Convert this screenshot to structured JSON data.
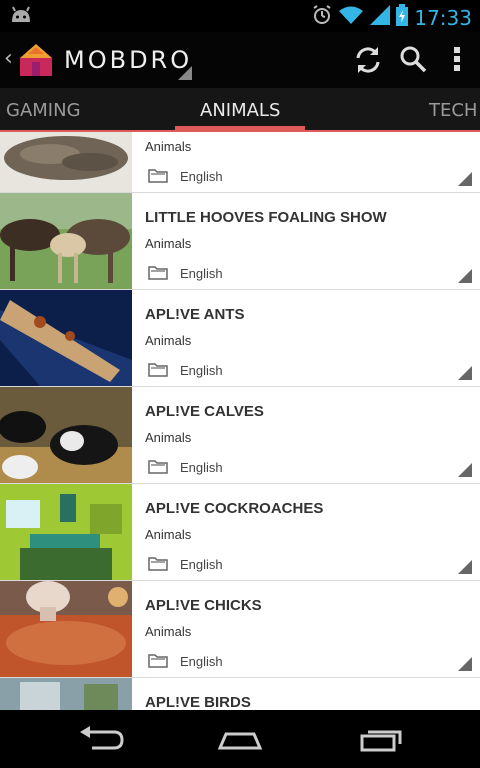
{
  "status": {
    "time": "17:33"
  },
  "header": {
    "title": "MOBDRO"
  },
  "tabs": [
    {
      "label": "GAMING"
    },
    {
      "label": "ANIMALS"
    },
    {
      "label": "TECH"
    }
  ],
  "streams": [
    {
      "title": "",
      "category": "Animals",
      "language": "English"
    },
    {
      "title": "LITTLE HOOVES FOALING SHOW",
      "category": "Animals",
      "language": "English"
    },
    {
      "title": "APL!VE ANTS",
      "category": "Animals",
      "language": "English"
    },
    {
      "title": "APL!VE CALVES",
      "category": "Animals",
      "language": "English"
    },
    {
      "title": "APL!VE COCKROACHES",
      "category": "Animals",
      "language": "English"
    },
    {
      "title": "APL!VE CHICKS",
      "category": "Animals",
      "language": "English"
    },
    {
      "title": "APL!VE BIRDS",
      "category": "",
      "language": ""
    }
  ],
  "icons": {
    "android": "android-icon",
    "alarm": "alarm-icon",
    "wifi": "wifi-icon",
    "signal": "signal-icon",
    "battery": "battery-icon",
    "refresh": "refresh-icon",
    "search": "search-icon",
    "overflow": "overflow-menu-icon",
    "folder": "folder-icon"
  },
  "colors": {
    "accent": "#e05a5a",
    "time": "#33b5e5"
  }
}
